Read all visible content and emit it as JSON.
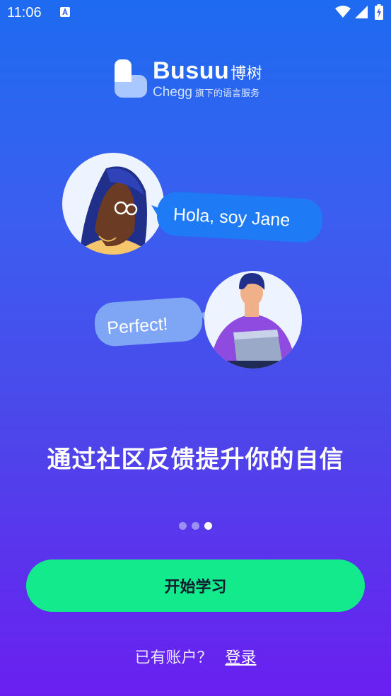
{
  "status_bar": {
    "time": "11:06",
    "app_icon": "keyboard-a-icon",
    "wifi_icon": "wifi-icon",
    "signal_icon": "signal-icon",
    "battery_icon": "battery-charging-icon"
  },
  "logo": {
    "brand": "Busuu",
    "brand_cn": "博树",
    "sub": "Chegg",
    "sub_cn": "旗下的语言服务"
  },
  "illustration": {
    "bubble_jane": "Hola, soy Jane",
    "bubble_reply": "Perfect!"
  },
  "headline": "通过社区反馈提升你的自信",
  "pagination": {
    "count": 3,
    "active_index": 2
  },
  "cta": {
    "label": "开始学习"
  },
  "login": {
    "prompt": "已有账户？",
    "link": "登录"
  },
  "colors": {
    "cta_background": "#12ea8c",
    "gradient_top": "#1d6bf0",
    "gradient_bottom": "#6a1ff0"
  }
}
